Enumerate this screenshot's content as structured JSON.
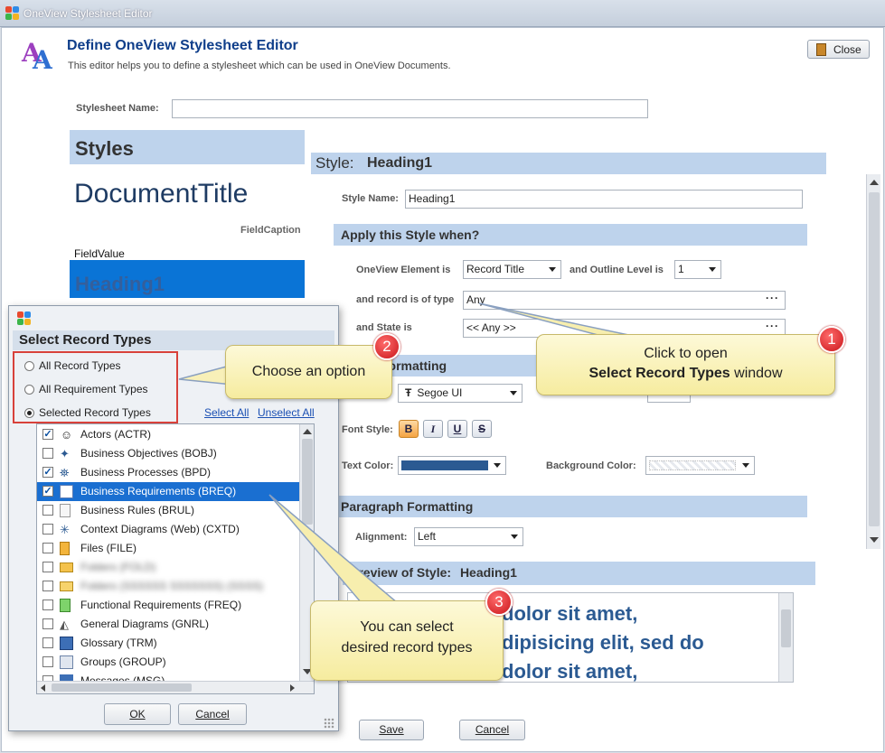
{
  "window": {
    "title": "OneView Stylesheet Editor",
    "close_label": "Close"
  },
  "header": {
    "title": "Define OneView Stylesheet Editor",
    "subtitle": "This editor helps you to define a stylesheet  which can be used in OneView Documents."
  },
  "stylesheet": {
    "name_label": "Stylesheet Name:",
    "name_value": ""
  },
  "styles_panel": {
    "title": "Styles",
    "items": [
      {
        "label": "DocumentTitle"
      },
      {
        "label": "FieldCaption"
      },
      {
        "label": "FieldValue"
      },
      {
        "label": "Heading1"
      }
    ]
  },
  "style": {
    "title_prefix": "Style:",
    "title_name": "Heading1",
    "name_label": "Style Name:",
    "name_value": "Heading1",
    "apply_title": "Apply this Style when?",
    "element_label": "OneView Element is",
    "element_value": "Record Title",
    "outline_label": "and Outline Level is",
    "outline_value": "1",
    "record_type_label": "and record is of type",
    "record_type_value": "Any",
    "state_label": "and State is",
    "state_value": "<< Any >>",
    "font_section": "Formatting",
    "font_value": "Segoe UI",
    "font_style_label": "Font Style:",
    "font_buttons": [
      "B",
      "I",
      "U",
      "S"
    ],
    "text_color_label": "Text Color:",
    "text_color": "#2b5a92",
    "bg_color_label": "Background Color:",
    "paragraph_title": "Paragraph Formatting",
    "alignment_label": "Alignment:",
    "alignment_value": "Left",
    "preview_title": "Preview of Style:",
    "preview_name": "Heading1",
    "preview_lines": [
      "dolor sit amet,",
      "dipisicing elit, sed do",
      "dolor sit amet,"
    ],
    "save_label": "Save",
    "cancel_label": "Cancel"
  },
  "dialog": {
    "title": "Select Record Types",
    "options": [
      "All Record Types",
      "All Requirement Types",
      "Selected Record Types"
    ],
    "select_all": "Select All",
    "unselect_all": "Unselect All",
    "items": [
      {
        "label": "Actors (ACTR)",
        "checked": true
      },
      {
        "label": "Business Objectives (BOBJ)",
        "checked": false
      },
      {
        "label": "Business Processes (BPD)",
        "checked": true
      },
      {
        "label": "Business Requirements (BREQ)",
        "checked": true
      },
      {
        "label": "Business Rules (BRUL)",
        "checked": false
      },
      {
        "label": "Context Diagrams (Web) (CXTD)",
        "checked": false
      },
      {
        "label": "Files (FILE)",
        "checked": false
      },
      {
        "label": "Folders (FOLD)",
        "checked": false
      },
      {
        "label": "Folders (SSSSSS SSSSSSS) (SSSS)",
        "checked": false
      },
      {
        "label": "Functional Requirements (FREQ)",
        "checked": false
      },
      {
        "label": "General Diagrams (GNRL)",
        "checked": false
      },
      {
        "label": "Glossary (TRM)",
        "checked": false
      },
      {
        "label": "Groups (GROUP)",
        "checked": false
      },
      {
        "label": "Messages (MSG)",
        "checked": false
      }
    ],
    "ok_label": "OK",
    "cancel_label": "Cancel"
  },
  "callouts": {
    "c1_line1": "Click to open",
    "c1_line2_bold": "Select Record Types",
    "c1_line2_rest": " window",
    "c1_badge": "1",
    "c2_text": "Choose an option",
    "c2_badge": "2",
    "c3_line1": "You can select",
    "c3_line2": "desired record types",
    "c3_badge": "3"
  }
}
